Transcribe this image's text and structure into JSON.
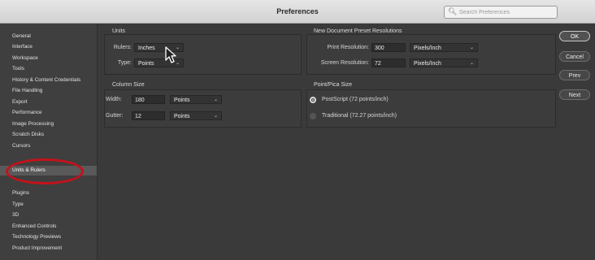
{
  "window": {
    "title": "Preferences"
  },
  "search": {
    "placeholder": "Search Preferences",
    "icon": "search-icon"
  },
  "sidebar": {
    "items": [
      {
        "label": "General"
      },
      {
        "label": "Interface"
      },
      {
        "label": "Workspace"
      },
      {
        "label": "Tools"
      },
      {
        "label": "History & Content Credentials"
      },
      {
        "label": "File Handling"
      },
      {
        "label": "Export"
      },
      {
        "label": "Performance"
      },
      {
        "label": "Image Processing"
      },
      {
        "label": "Scratch Disks"
      },
      {
        "label": "Cursors"
      },
      {
        "label": ""
      },
      {
        "label": "Units & Rulers",
        "selected": true
      },
      {
        "label": ""
      },
      {
        "label": "Plugins"
      },
      {
        "label": "Type"
      },
      {
        "label": "3D"
      },
      {
        "label": "Enhanced Controls"
      },
      {
        "label": "Technology Previews"
      },
      {
        "label": "Product Improvement"
      }
    ]
  },
  "units": {
    "title": "Units",
    "rulers_label": "Rulers:",
    "rulers_value": "Inches",
    "type_label": "Type:",
    "type_value": "Points"
  },
  "column_size": {
    "title": "Column Size",
    "width_label": "Width:",
    "width_value": "180",
    "width_unit": "Points",
    "gutter_label": "Gutter:",
    "gutter_value": "12",
    "gutter_unit": "Points"
  },
  "resolutions": {
    "title": "New Document Preset Resolutions",
    "print_label": "Print Resolution:",
    "print_value": "300",
    "print_unit": "Pixels/Inch",
    "screen_label": "Screen Resolution:",
    "screen_value": "72",
    "screen_unit": "Pixels/Inch"
  },
  "point_pica": {
    "title": "Point/Pica Size",
    "options": [
      {
        "label": "PostScript (72 points/inch)",
        "selected": true
      },
      {
        "label": "Traditional (72.27 points/inch)",
        "selected": false
      }
    ]
  },
  "buttons": {
    "ok": "OK",
    "cancel": "Cancel",
    "prev": "Prev",
    "next": "Next"
  },
  "colors": {
    "highlight_ring": "#c4121a",
    "selected_item": "#595959"
  }
}
